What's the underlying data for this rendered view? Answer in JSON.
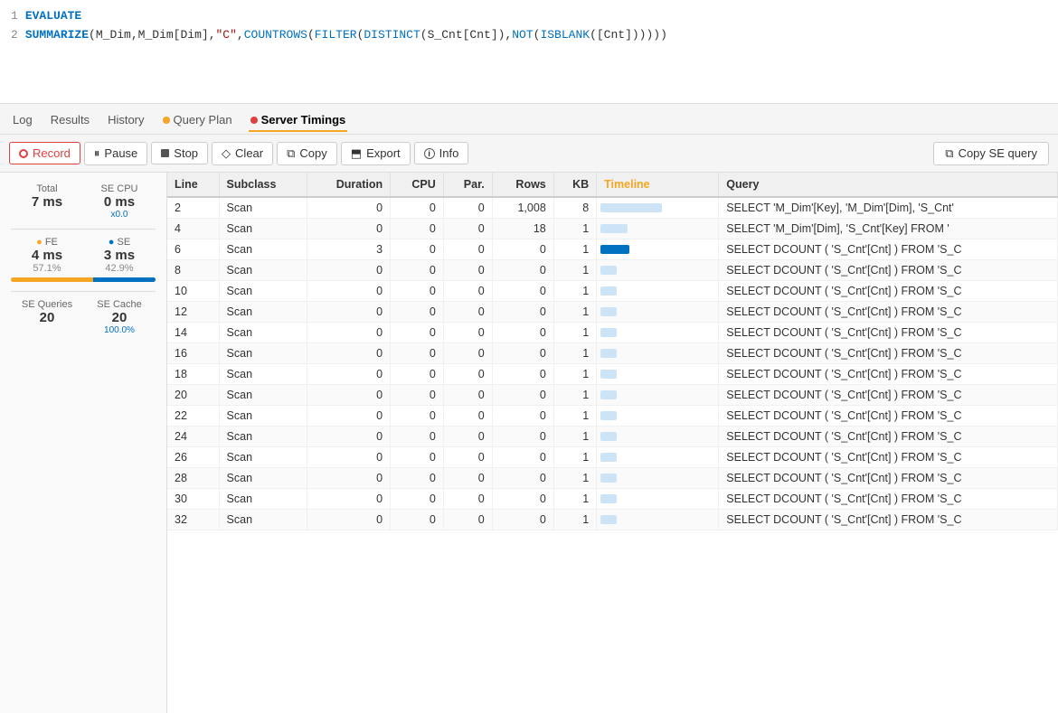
{
  "editor": {
    "lines": [
      {
        "num": 1,
        "content": "EVALUATE",
        "type": "keyword"
      },
      {
        "num": 2,
        "content": "SUMMARIZE(M_Dim,M_Dim[Dim],\"C\",COUNTROWS(FILTER(DISTINCT(S_Cnt[Cnt]),NOT(ISBLANK([Cnt])))))",
        "type": "expression"
      }
    ]
  },
  "tabs": {
    "items": [
      {
        "label": "Log",
        "active": false,
        "dot": null
      },
      {
        "label": "Results",
        "active": false,
        "dot": null
      },
      {
        "label": "History",
        "active": false,
        "dot": null
      },
      {
        "label": "Query Plan",
        "active": false,
        "dot": "yellow"
      },
      {
        "label": "Server Timings",
        "active": true,
        "dot": "red"
      }
    ]
  },
  "toolbar": {
    "record_label": "Record",
    "pause_label": "Pause",
    "stop_label": "Stop",
    "clear_label": "Clear",
    "copy_label": "Copy",
    "export_label": "Export",
    "info_label": "Info",
    "copy_se_label": "Copy SE query"
  },
  "metrics": {
    "total_label": "Total",
    "total_value": "7 ms",
    "se_cpu_label": "SE CPU",
    "se_cpu_value": "0 ms",
    "se_cpu_ratio": "x0.0",
    "fe_label": "FE",
    "fe_value": "4 ms",
    "fe_pct": "57.1%",
    "se_label": "SE",
    "se_value": "3 ms",
    "se_pct": "42.9%",
    "fe_bar_width": 57,
    "se_bar_width": 43,
    "se_queries_label": "SE Queries",
    "se_queries_value": "20",
    "se_cache_label": "SE Cache",
    "se_cache_value": "20",
    "se_cache_pct": "100.0%"
  },
  "table": {
    "columns": [
      "Line",
      "Subclass",
      "Duration",
      "CPU",
      "Par.",
      "Rows",
      "KB",
      "Timeline",
      "Query"
    ],
    "rows": [
      {
        "line": 2,
        "subclass": "Scan",
        "duration": 0,
        "cpu": 0,
        "par": 0,
        "rows": "1,008",
        "kb": 8,
        "tl_type": "wide_accent",
        "query": "SELECT 'M_Dim'[Key], 'M_Dim'[Dim], 'S_Cnt'"
      },
      {
        "line": 4,
        "subclass": "Scan",
        "duration": 0,
        "cpu": 0,
        "par": 0,
        "rows": 18,
        "kb": 1,
        "tl_type": "short_bg",
        "query": "SELECT 'M_Dim'[Dim], 'S_Cnt'[Key] FROM '"
      },
      {
        "line": 6,
        "subclass": "Scan",
        "duration": 3,
        "cpu": 0,
        "par": 0,
        "rows": 0,
        "kb": 1,
        "tl_type": "accent",
        "query": "SELECT DCOUNT ( 'S_Cnt'[Cnt] ) FROM 'S_C"
      },
      {
        "line": 8,
        "subclass": "Scan",
        "duration": 0,
        "cpu": 0,
        "par": 0,
        "rows": 0,
        "kb": 1,
        "tl_type": "tiny_bg",
        "query": "SELECT DCOUNT ( 'S_Cnt'[Cnt] ) FROM 'S_C"
      },
      {
        "line": 10,
        "subclass": "Scan",
        "duration": 0,
        "cpu": 0,
        "par": 0,
        "rows": 0,
        "kb": 1,
        "tl_type": "tiny_bg",
        "query": "SELECT DCOUNT ( 'S_Cnt'[Cnt] ) FROM 'S_C"
      },
      {
        "line": 12,
        "subclass": "Scan",
        "duration": 0,
        "cpu": 0,
        "par": 0,
        "rows": 0,
        "kb": 1,
        "tl_type": "tiny_bg",
        "query": "SELECT DCOUNT ( 'S_Cnt'[Cnt] ) FROM 'S_C"
      },
      {
        "line": 14,
        "subclass": "Scan",
        "duration": 0,
        "cpu": 0,
        "par": 0,
        "rows": 0,
        "kb": 1,
        "tl_type": "tiny_bg",
        "query": "SELECT DCOUNT ( 'S_Cnt'[Cnt] ) FROM 'S_C"
      },
      {
        "line": 16,
        "subclass": "Scan",
        "duration": 0,
        "cpu": 0,
        "par": 0,
        "rows": 0,
        "kb": 1,
        "tl_type": "tiny_bg",
        "query": "SELECT DCOUNT ( 'S_Cnt'[Cnt] ) FROM 'S_C"
      },
      {
        "line": 18,
        "subclass": "Scan",
        "duration": 0,
        "cpu": 0,
        "par": 0,
        "rows": 0,
        "kb": 1,
        "tl_type": "tiny_bg",
        "query": "SELECT DCOUNT ( 'S_Cnt'[Cnt] ) FROM 'S_C"
      },
      {
        "line": 20,
        "subclass": "Scan",
        "duration": 0,
        "cpu": 0,
        "par": 0,
        "rows": 0,
        "kb": 1,
        "tl_type": "tiny_bg",
        "query": "SELECT DCOUNT ( 'S_Cnt'[Cnt] ) FROM 'S_C"
      },
      {
        "line": 22,
        "subclass": "Scan",
        "duration": 0,
        "cpu": 0,
        "par": 0,
        "rows": 0,
        "kb": 1,
        "tl_type": "tiny_bg",
        "query": "SELECT DCOUNT ( 'S_Cnt'[Cnt] ) FROM 'S_C"
      },
      {
        "line": 24,
        "subclass": "Scan",
        "duration": 0,
        "cpu": 0,
        "par": 0,
        "rows": 0,
        "kb": 1,
        "tl_type": "tiny_bg",
        "query": "SELECT DCOUNT ( 'S_Cnt'[Cnt] ) FROM 'S_C"
      },
      {
        "line": 26,
        "subclass": "Scan",
        "duration": 0,
        "cpu": 0,
        "par": 0,
        "rows": 0,
        "kb": 1,
        "tl_type": "tiny_bg",
        "query": "SELECT DCOUNT ( 'S_Cnt'[Cnt] ) FROM 'S_C"
      },
      {
        "line": 28,
        "subclass": "Scan",
        "duration": 0,
        "cpu": 0,
        "par": 0,
        "rows": 0,
        "kb": 1,
        "tl_type": "tiny_bg",
        "query": "SELECT DCOUNT ( 'S_Cnt'[Cnt] ) FROM 'S_C"
      },
      {
        "line": 30,
        "subclass": "Scan",
        "duration": 0,
        "cpu": 0,
        "par": 0,
        "rows": 0,
        "kb": 1,
        "tl_type": "tiny_bg",
        "query": "SELECT DCOUNT ( 'S_Cnt'[Cnt] ) FROM 'S_C"
      },
      {
        "line": 32,
        "subclass": "Scan",
        "duration": 0,
        "cpu": 0,
        "par": 0,
        "rows": 0,
        "kb": 1,
        "tl_type": "tiny_bg",
        "query": "SELECT DCOUNT ( 'S_Cnt'[Cnt] ) FROM 'S_C"
      }
    ]
  }
}
